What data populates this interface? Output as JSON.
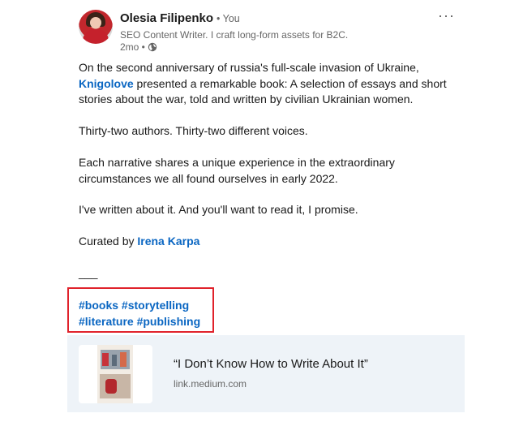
{
  "author": {
    "name": "Olesia Filipenko",
    "relation": "• You",
    "headline": "SEO Content Writer. I craft long-form assets for B2C.",
    "time": "2mo •"
  },
  "icons": {
    "more": "more-options-icon",
    "visibility": "globe-icon"
  },
  "post": {
    "p1_text_a": "On the second anniversary of russia's full-scale invasion of Ukraine, ",
    "p1_mention": "Knigolove",
    "p1_text_b": " presented a remarkable book: A selection of essays and short stories about the war, told and written by civilian Ukrainian women.",
    "p2": "Thirty-two authors. Thirty-two different voices.",
    "p3": "Each narrative shares a unique experience in the extraordinary circumstances we all found ourselves in early 2022.",
    "p4": "I've written about it. And you'll want to read it, I promise.",
    "p5_text": "Curated by ",
    "p5_mention": "Irena Karpa",
    "divider": "___",
    "hashtags_line1": "#books #storytelling",
    "hashtags_line2": "#literature #publishing"
  },
  "link_preview": {
    "title": "“I Don’t Know How to Write About It”",
    "domain": "link.medium.com"
  },
  "colors": {
    "link": "#0a66c2",
    "highlight_box": "#e0222b",
    "card_bg": "#eef3f8"
  }
}
